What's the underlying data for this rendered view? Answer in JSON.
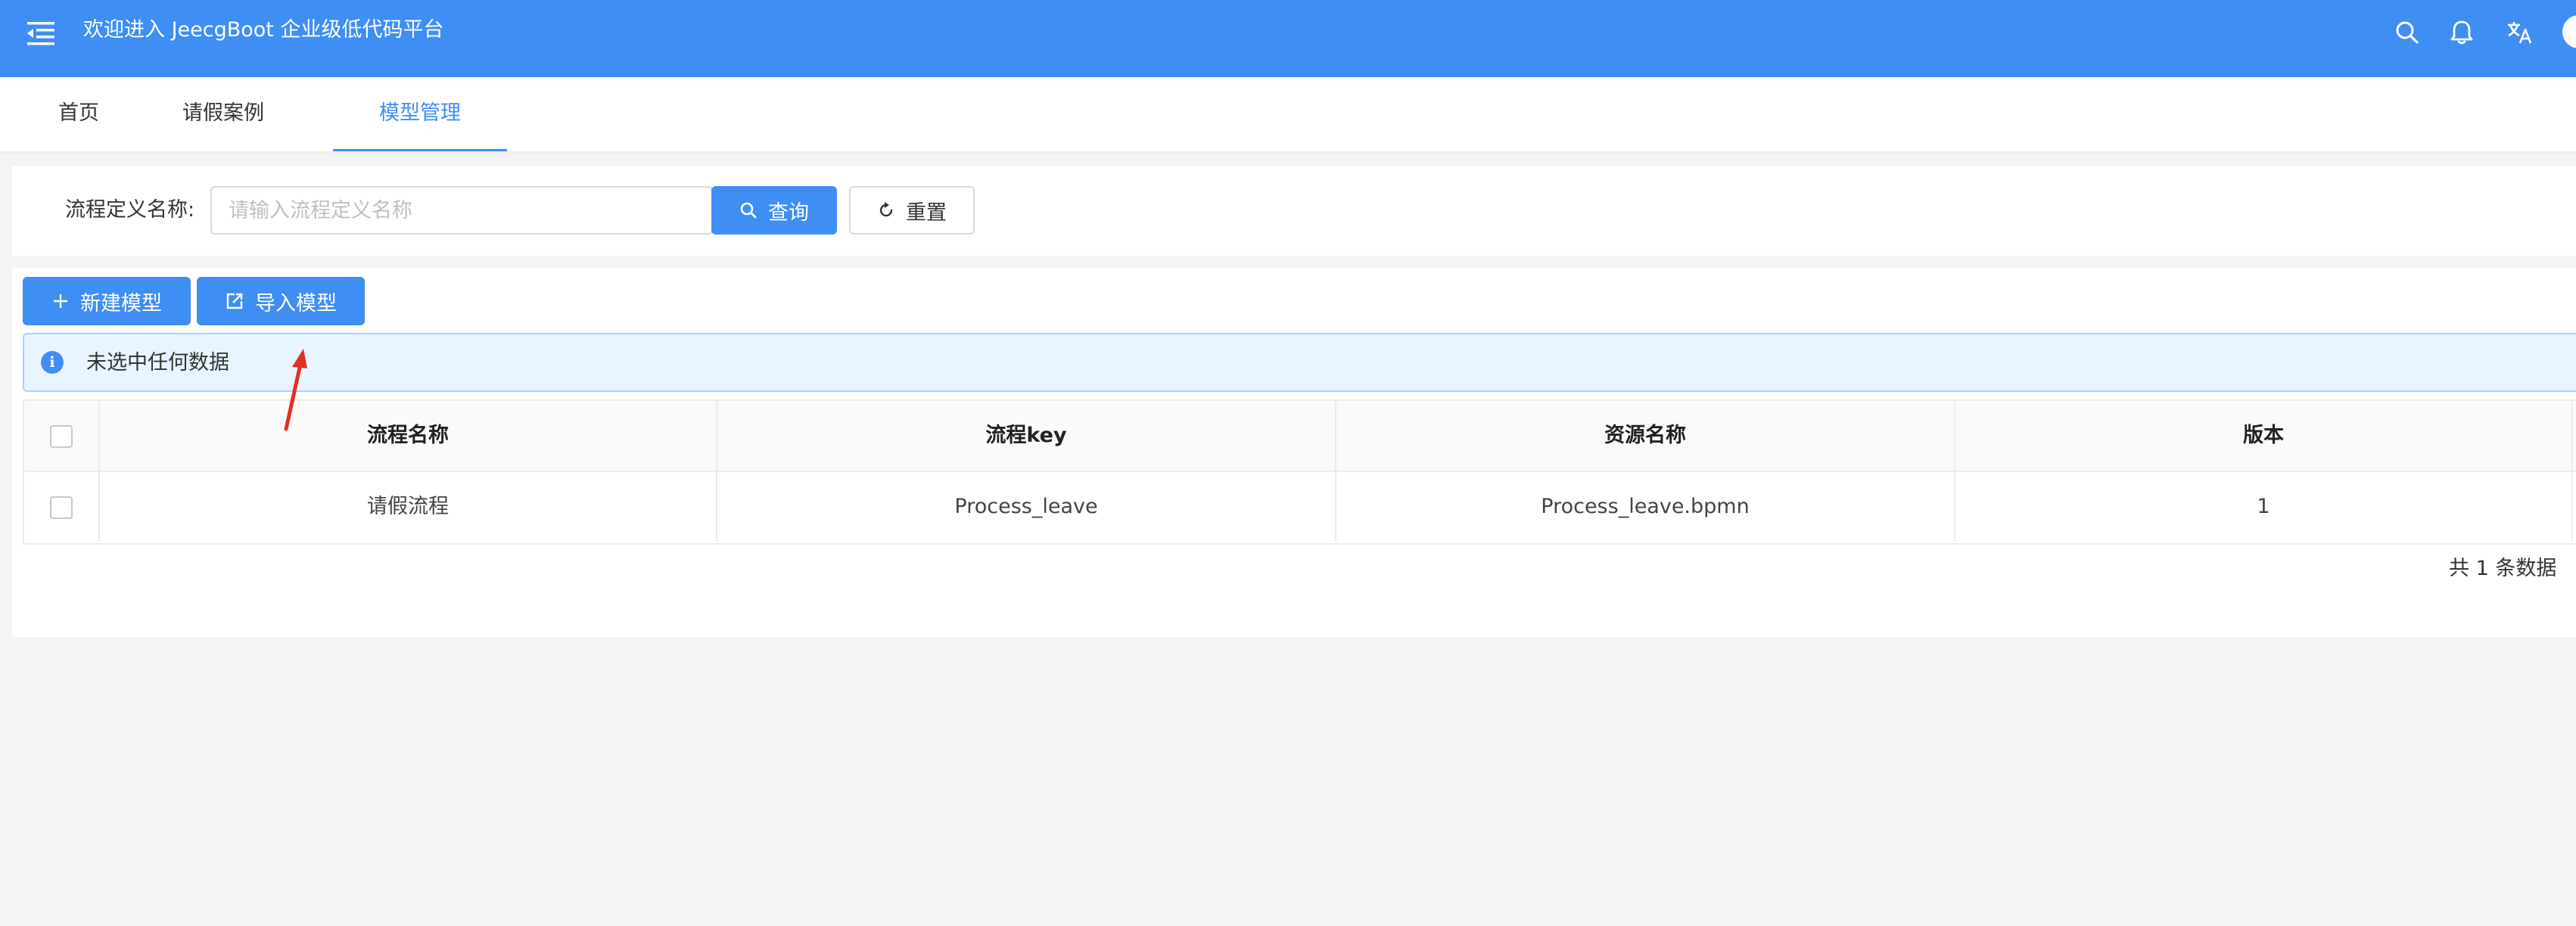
{
  "header": {
    "title": "欢迎进入 JeecgBoot 企业级低代码平台",
    "icons": [
      "menu-fold-icon",
      "search-icon",
      "bell-icon",
      "translate-icon",
      "avatar"
    ],
    "color": "#3f8ef3"
  },
  "tabs": [
    {
      "label": "首页",
      "active": false
    },
    {
      "label": "请假案例",
      "active": false
    },
    {
      "label": "模型管理",
      "active": true
    }
  ],
  "search": {
    "label": "流程定义名称",
    "placeholder": "请输入流程定义名称",
    "query_label": "查询",
    "reset_label": "重置"
  },
  "toolbar": {
    "new_model_label": "新建模型",
    "import_model_label": "导入模型"
  },
  "alert": {
    "text": "未选中任何数据"
  },
  "table": {
    "columns": [
      "流程名称",
      "流程key",
      "资源名称",
      "版本"
    ],
    "rows": [
      [
        "请假流程",
        "Process_leave",
        "Process_leave.bpmn",
        "1"
      ]
    ]
  },
  "pagination": {
    "total_text": "共 1 条数据"
  },
  "colors": {
    "primary": "#3f8ef3",
    "annotation_arrow": "#e0321e"
  }
}
